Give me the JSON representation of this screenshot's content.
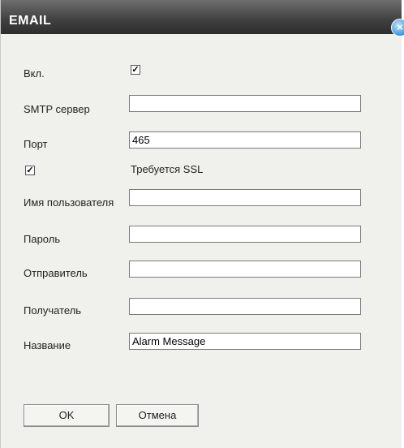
{
  "window": {
    "title": "EMAIL",
    "close_glyph": "×"
  },
  "form": {
    "enable_label": "Вкл.",
    "enable_checked": true,
    "smtp_label": "SMTP сервер",
    "smtp_value": "",
    "port_label": "Порт",
    "port_value": "465",
    "ssl_label": "Требуется SSL",
    "ssl_checked": true,
    "username_label": "Имя пользователя",
    "username_value": "",
    "password_label": "Пароль",
    "password_value": "",
    "sender_label": "Отправитель",
    "sender_value": "",
    "recipient_label": "Получатель",
    "recipient_value": "",
    "subject_label": "Название",
    "subject_value": "Alarm Message"
  },
  "buttons": {
    "ok_label": "OK",
    "cancel_label": "Отмена"
  },
  "check_glyph": "✓"
}
